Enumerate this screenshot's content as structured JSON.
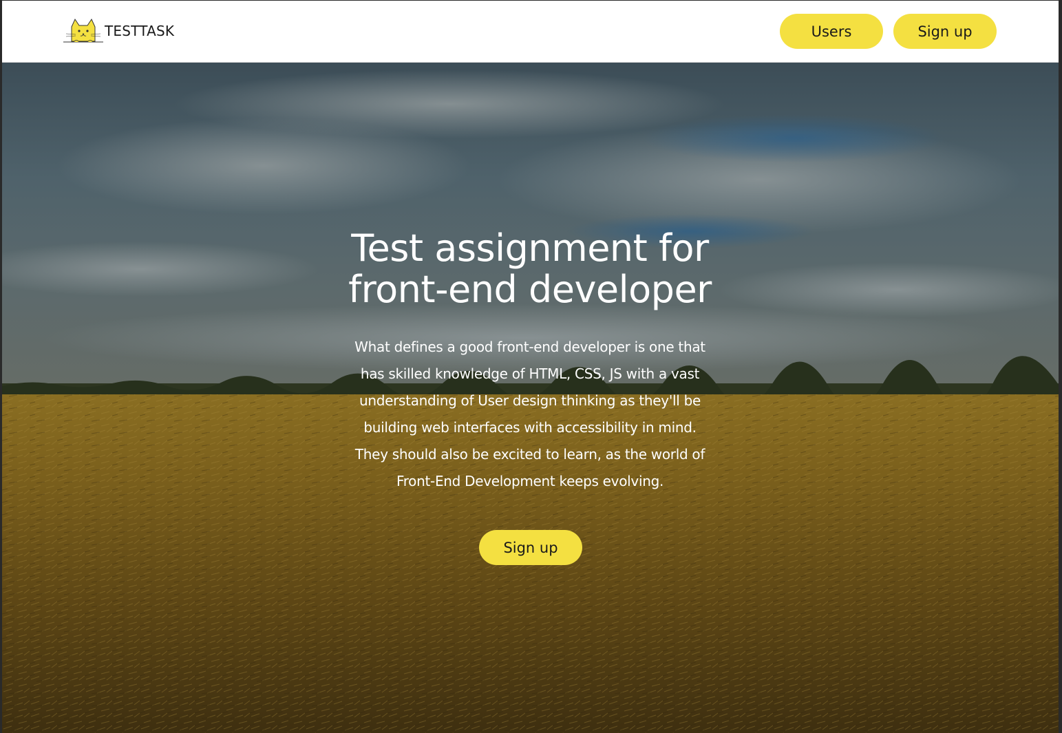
{
  "header": {
    "logo": {
      "text": "TESTTASK",
      "icon": "cat-logo-icon"
    },
    "nav": {
      "users_label": "Users",
      "signup_label": "Sign up"
    }
  },
  "hero": {
    "title_line1": "Test assignment for",
    "title_line2": "front-end developer",
    "description_lines": [
      "What defines a good front-end developer is one that",
      "has skilled knowledge of HTML, CSS, JS with a vast",
      "understanding of User design thinking as they'll be",
      "building web interfaces with accessibility in mind.",
      "They should also be excited to learn, as the world of",
      "Front-End Development keeps evolving."
    ],
    "cta_label": "Sign up",
    "background": "wheat-field-sky-photo"
  },
  "colors": {
    "accent": "#f4e041",
    "text_dark": "#1a1a1a",
    "text_light": "#ffffff"
  }
}
